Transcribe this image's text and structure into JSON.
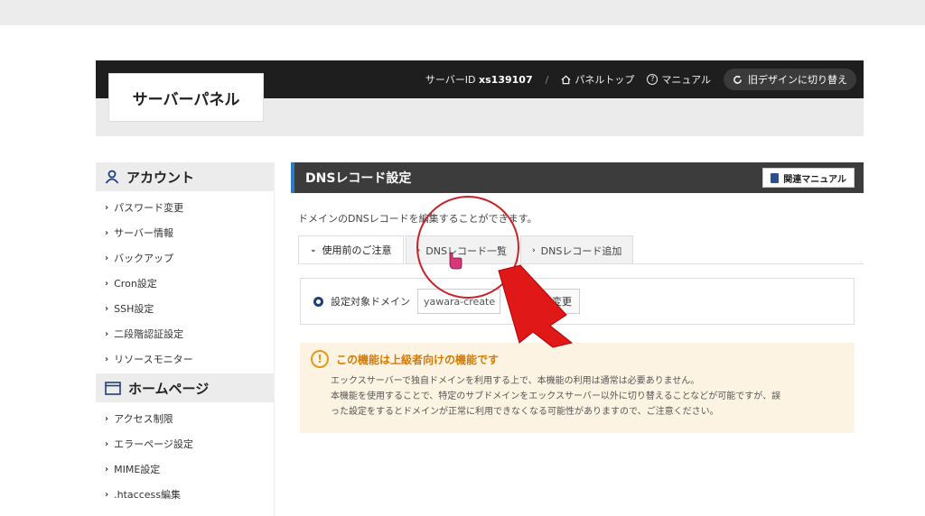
{
  "header": {
    "logo": "サーバーパネル",
    "server_id_label": "サーバーID",
    "server_id": "xs139107",
    "separator": "/",
    "panel_top": "パネルトップ",
    "manual": "マニュアル",
    "old_design": "旧デザインに切り替え"
  },
  "sidebar": {
    "account": {
      "title": "アカウント",
      "items": [
        "パスワード変更",
        "サーバー情報",
        "バックアップ",
        "Cron設定",
        "SSH設定",
        "二段階認証設定",
        "リソースモニター"
      ]
    },
    "homepage": {
      "title": "ホームページ",
      "items": [
        "アクセス制限",
        "エラーページ設定",
        "MIME設定",
        ".htaccess編集"
      ]
    }
  },
  "main": {
    "title": "DNSレコード設定",
    "related_manual": "関連マニュアル",
    "description": "ドメインのDNSレコードを編集することができます。",
    "tabs": [
      {
        "label": "使用前のご注意"
      },
      {
        "label": "DNSレコード一覧"
      },
      {
        "label": "DNSレコード追加"
      }
    ],
    "domain_label": "設定対象ドメイン",
    "domain_value": "yawara-create",
    "change_button": "変更",
    "warning": {
      "title": "この機能は上級者向けの機能です",
      "line1": "エックスサーバーで独自ドメインを利用する上で、本機能の利用は通常は必要ありません。",
      "line2": "本機能を使用することで、特定のサブドメインをエックスサーバー以外に切り替えることなどが可能ですが、誤",
      "line3": "った設定をするとドメインが正常に利用できなくなる可能性がありますので、ご注意ください。"
    }
  },
  "colors": {
    "accent_blue": "#2a7cd1",
    "warning_orange": "#d97a00",
    "annotation_red": "#e01818"
  }
}
